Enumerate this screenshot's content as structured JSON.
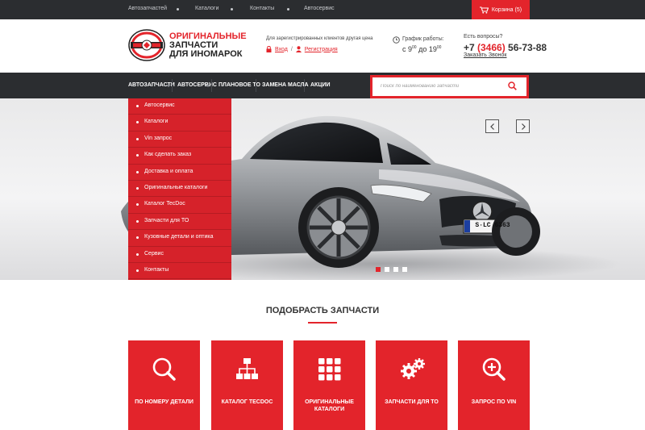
{
  "topbar": {
    "links": [
      "Автозапчастей",
      "Каталоги",
      "Контакты",
      "Автосервис"
    ],
    "cart_label": "Корзина (5)"
  },
  "header": {
    "brand_lines": [
      "ОРИГИНАЛЬНЫЕ",
      "ЗАПЧАСТИ",
      "ДЛЯ ИНОМАРОК"
    ],
    "reg_info": "Для зарегистрированных клиентов другая цена",
    "login_label": "Вход",
    "separator": "/",
    "register_label": "Регистрация",
    "schedule_label": "График работы:",
    "schedule_prefix": "с 9",
    "schedule_from_sup": "00",
    "schedule_to": " до 19",
    "schedule_to_sup": "00",
    "questions_label": "Есть вопросы?",
    "phone_prefix": "+7 ",
    "phone_code": "(3466)",
    "phone_number": " 56-73-88",
    "callback_label": "Заказать Звонок"
  },
  "nav": {
    "items": [
      "АВТОЗАПЧАСТИ",
      "АВТОСЕРВИС",
      "ПЛАНОВОЕ ТО",
      "ЗАМЕНА МАСЛА",
      "АКЦИИ"
    ],
    "search_placeholder": "Поиск по наименованию запчасти"
  },
  "side_menu": {
    "items": [
      "Автосервис",
      "Каталоги",
      "Vin запрос",
      "Как сделать заказ",
      "Доставка и оплата",
      "Оригинальные каталоги",
      "Каталог TecDoc",
      "Запчасти для ТО",
      "Кузовные детали и оптика",
      "Сервис",
      "Контакты"
    ]
  },
  "hero": {
    "plate_text": "S·LC 6363",
    "slides_total": 4,
    "slide_active": 1
  },
  "section": {
    "title": "ПОДОБРАСТЬ ЗАПЧАСТИ",
    "tiles": [
      {
        "label": "ПО НОМЕРУ ДЕТАЛИ",
        "icon": "search-icon"
      },
      {
        "label": "КАТАЛОГ TECDOC",
        "icon": "sitemap-icon"
      },
      {
        "label": "ОРИГИНАЛЬНЫЕ КАТАЛОГИ",
        "icon": "grid-icon"
      },
      {
        "label": "ЗАПЧАСТИ ДЛЯ ТО",
        "icon": "gears-icon"
      },
      {
        "label": "ЗАПРОС ПО VIN",
        "icon": "zoom-plus-icon"
      }
    ]
  },
  "colors": {
    "accent": "#e3242b",
    "dark": "#2b2d30",
    "menu_red": "#d6222a"
  }
}
